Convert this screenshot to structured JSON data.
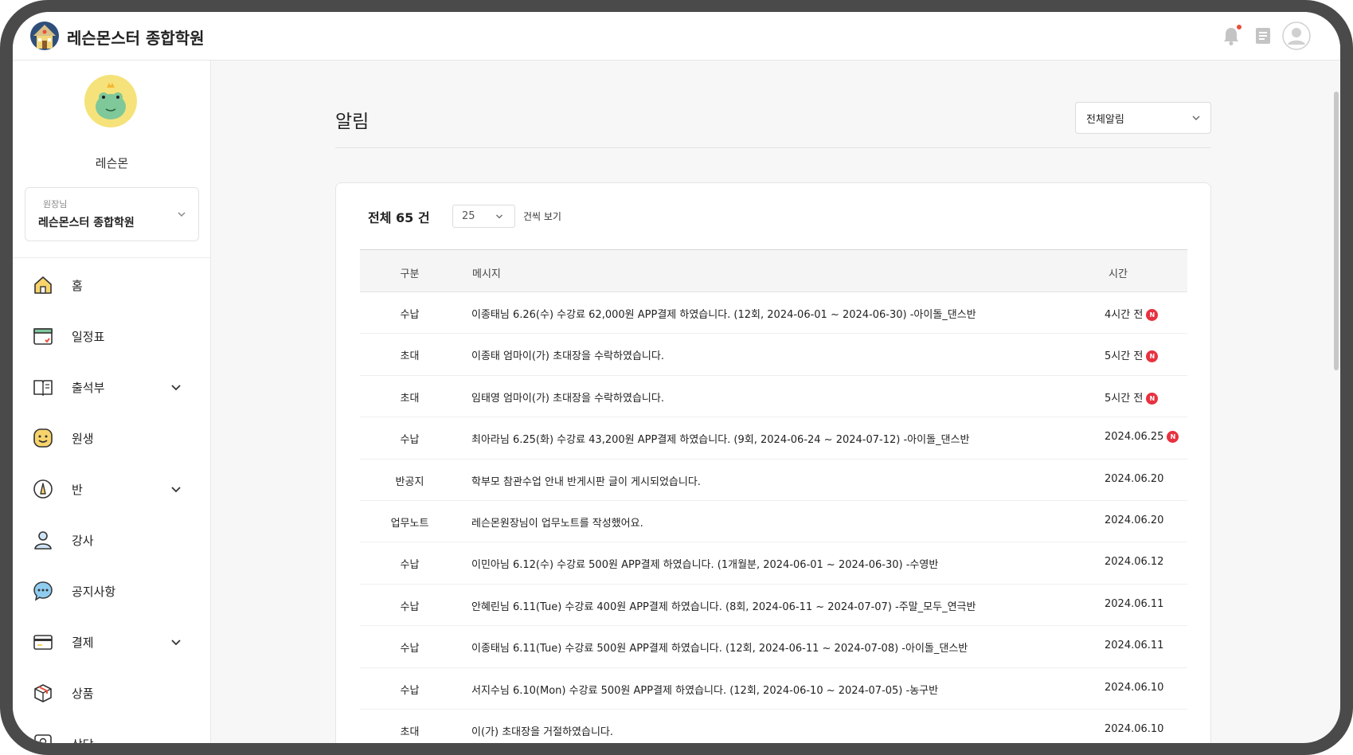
{
  "header": {
    "brand": "레슨몬스터 종합학원",
    "icons": [
      "logo-icon",
      "bell-icon",
      "memo-icon",
      "profile-icon"
    ]
  },
  "sidebar": {
    "user_name": "레슨몬",
    "academy": {
      "role": "원장님",
      "name": "레슨몬스터 종합학원"
    },
    "items": [
      {
        "label": "홈",
        "icon": "home-icon",
        "expandable": false
      },
      {
        "label": "일정표",
        "icon": "calendar-icon",
        "expandable": false
      },
      {
        "label": "출석부",
        "icon": "book-icon",
        "expandable": true
      },
      {
        "label": "원생",
        "icon": "smile-icon",
        "expandable": false
      },
      {
        "label": "반",
        "icon": "pen-icon",
        "expandable": true
      },
      {
        "label": "강사",
        "icon": "person-icon",
        "expandable": false
      },
      {
        "label": "공지사항",
        "icon": "chat-icon",
        "expandable": false
      },
      {
        "label": "결제",
        "icon": "card-icon",
        "expandable": true
      },
      {
        "label": "상품",
        "icon": "box-icon",
        "expandable": false
      },
      {
        "label": "상담",
        "icon": "contact-icon",
        "expandable": false
      }
    ]
  },
  "main": {
    "title": "알림",
    "filter": "전체알림",
    "total": "전체 65 건",
    "per_page": "25",
    "per_page_suffix": "건씩 보기",
    "columns": {
      "category": "구분",
      "message": "메시지",
      "time": "시간"
    },
    "badge_text": "N",
    "rows": [
      {
        "category": "수납",
        "message": "이종태님 6.26(수) 수강료 62,000원 APP결제 하였습니다. (12회, 2024-06-01 ~ 2024-06-30) -아이돌_댄스반",
        "time": "4시간 전",
        "new": "N"
      },
      {
        "category": "초대",
        "message": "이종태 엄마이(가) 초대장을 수락하였습니다.",
        "time": "5시간 전",
        "new": "N"
      },
      {
        "category": "초대",
        "message": "임태영 엄마이(가) 초대장을 수락하였습니다.",
        "time": "5시간 전",
        "new": "N"
      },
      {
        "category": "수납",
        "message": "최아라님 6.25(화) 수강료 43,200원 APP결제 하였습니다. (9회, 2024-06-24 ~ 2024-07-12) -아이돌_댄스반",
        "time": "2024.06.25",
        "new": "N"
      },
      {
        "category": "반공지",
        "message": "학부모 참관수업 안내 반게시판 글이 게시되었습니다.",
        "time": "2024.06.20",
        "new": ""
      },
      {
        "category": "업무노트",
        "message": "레슨몬원장님이 업무노트를 작성했어요.",
        "time": "2024.06.20",
        "new": ""
      },
      {
        "category": "수납",
        "message": "이민아님 6.12(수) 수강료 500원 APP결제 하였습니다. (1개월분, 2024-06-01 ~ 2024-06-30) -수영반",
        "time": "2024.06.12",
        "new": ""
      },
      {
        "category": "수납",
        "message": "안혜린님 6.11(Tue) 수강료 400원 APP결제 하였습니다. (8회, 2024-06-11 ~ 2024-07-07) -주말_모두_연극반",
        "time": "2024.06.11",
        "new": ""
      },
      {
        "category": "수납",
        "message": "이종태님 6.11(Tue) 수강료 500원 APP결제 하였습니다. (12회, 2024-06-11 ~ 2024-07-08) -아이돌_댄스반",
        "time": "2024.06.11",
        "new": ""
      },
      {
        "category": "수납",
        "message": "서지수님 6.10(Mon) 수강료 500원 APP결제 하였습니다. (12회, 2024-06-10 ~ 2024-07-05) -농구반",
        "time": "2024.06.10",
        "new": ""
      },
      {
        "category": "초대",
        "message": "이(가) 초대장을 거절하였습니다.",
        "time": "2024.06.10",
        "new": ""
      }
    ]
  },
  "colors": {
    "frame": "#4a4a4a",
    "background": "#f7f7f7",
    "badge": "#e8313f",
    "notification_dot": "#e8503a",
    "avatar_bg": "#f6e27a",
    "avatar_face": "#7ec89a"
  }
}
